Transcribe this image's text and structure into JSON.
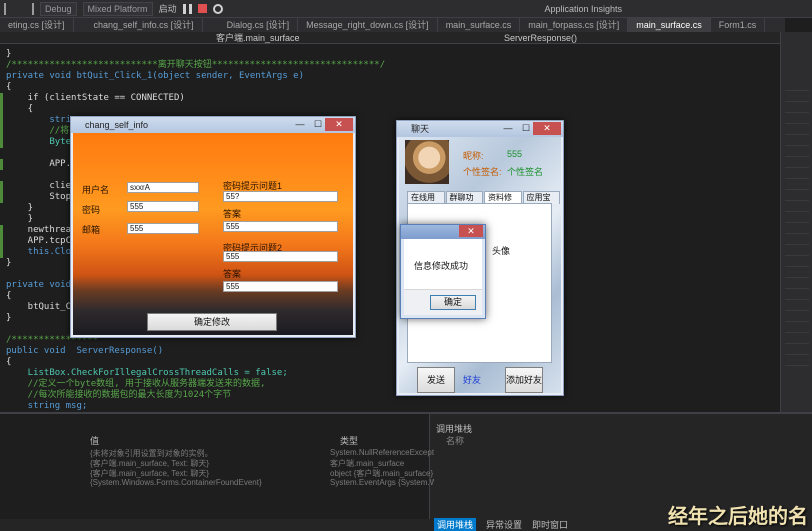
{
  "toolbar": {
    "config": "Debug",
    "platform": "Mixed Platform",
    "start_label": "启动",
    "insights": "Application Insights"
  },
  "tabs": [
    {
      "label": "eting.cs [设计]"
    },
    {
      "label": "chang_self_info.cs [设计]"
    },
    {
      "label": "Dialog.cs [设计]"
    },
    {
      "label": "Message_right_down.cs [设计]"
    },
    {
      "label": "main_surface.cs"
    },
    {
      "label": "main_forpass.cs [设计]"
    },
    {
      "label": "main_surface.cs"
    },
    {
      "label": "Form1.cs"
    }
  ],
  "nav": {
    "left": "客户端.main_surface",
    "right": "ServerResponse()"
  },
  "code": [
    {
      "t": "}",
      "c": "tx"
    },
    {
      "t": "/***************************离开聊天按钮*******************************/",
      "c": "cm"
    },
    {
      "t": "private void btQuit_Click_1(object sender, EventArgs e)",
      "c": "kw"
    },
    {
      "t": "{",
      "c": "tx"
    },
    {
      "t": "    if (clientState == CONNECTED)",
      "c": "tx"
    },
    {
      "t": "    {",
      "c": "tx"
    },
    {
      "t": "        string",
      "c": "kw"
    },
    {
      "t": "        //将字",
      "c": "cm"
    },
    {
      "t": "        Byte[]",
      "c": "ty"
    },
    {
      "t": "",
      "c": "tx"
    },
    {
      "t": "        APP.ns",
      "c": "tx"
    },
    {
      "t": "",
      "c": "tx"
    },
    {
      "t": "        client",
      "c": "tx"
    },
    {
      "t": "        StopFl",
      "c": "tx"
    },
    {
      "t": "    }",
      "c": "tx"
    },
    {
      "t": "    }",
      "c": "tx"
    },
    {
      "t": "    newthread",
      "c": "tx"
    },
    {
      "t": "    APP.tcpCli",
      "c": "tx"
    },
    {
      "t": "    this.Close",
      "c": "kw"
    },
    {
      "t": "}",
      "c": "tx"
    },
    {
      "t": "",
      "c": "tx"
    },
    {
      "t": "private void m",
      "c": "kw"
    },
    {
      "t": "{",
      "c": "tx"
    },
    {
      "t": "    btQuit_Cli",
      "c": "tx"
    },
    {
      "t": "}",
      "c": "tx"
    },
    {
      "t": "",
      "c": "tx"
    },
    {
      "t": "/****************",
      "c": "cm"
    },
    {
      "t": "public void  ServerResponse()",
      "c": "kw"
    },
    {
      "t": "{",
      "c": "tx"
    },
    {
      "t": "    ListBox.CheckForIllegalCrossThreadCalls = false;",
      "c": "ty"
    },
    {
      "t": "    //定义一个byte数组, 用于接收从服务器端发送来的数据,",
      "c": "cm"
    },
    {
      "t": "    //每次所能接收的数据包的最大长度为1024个字节",
      "c": "cm"
    },
    {
      "t": "    string msg;",
      "c": "kw"
    }
  ],
  "bottom": {
    "left_header_a": "值",
    "left_header_b": "类型",
    "left_rows": [
      "{未将对象引用设置到对象的实例。",
      "{客户端.main_surface, Text: 聊天}",
      "{客户端.main_surface, Text: 聊天}",
      "{System.Windows.Forms.ContainerFoundEvent}"
    ],
    "left_types": [
      "System.NullReferenceException",
      "客户端.main_surface",
      "object {客户端.main_surface}",
      "System.EventArgs {System.Windows.F"
    ],
    "right_title": "调用堆栈",
    "right_header": "名称",
    "tabs": [
      "调用堆栈",
      "异常设置",
      "即时窗口"
    ],
    "subtitle": "经年之后她的名"
  },
  "self_info": {
    "title": "chang_self_info",
    "labels": {
      "username": "用户名",
      "password": "密码",
      "email": "邮箱",
      "q1": "密码提示问题1",
      "a1": "答案",
      "q2": "密码提示问题2",
      "a2": "答案"
    },
    "values": {
      "username": "sxxrA",
      "password": "555",
      "email": "555",
      "q1": "55?",
      "a1": "555",
      "q2": "555",
      "a2": "555"
    },
    "confirm": "确定修改"
  },
  "main_surface": {
    "title": "聊天",
    "nickname_label": "昵称:",
    "nickname": "555",
    "sig_label": "个性签名:",
    "sig": "个性签名",
    "tabs": [
      "在线用户",
      "群聊功能",
      "资料修改",
      "应用宝盒"
    ],
    "panel_text": "头像",
    "buttons": {
      "send": "发送",
      "middle": "好友",
      "add": "添加好友"
    }
  },
  "msgbox": {
    "title": "",
    "message": "信息修改成功",
    "ok": "确定"
  }
}
